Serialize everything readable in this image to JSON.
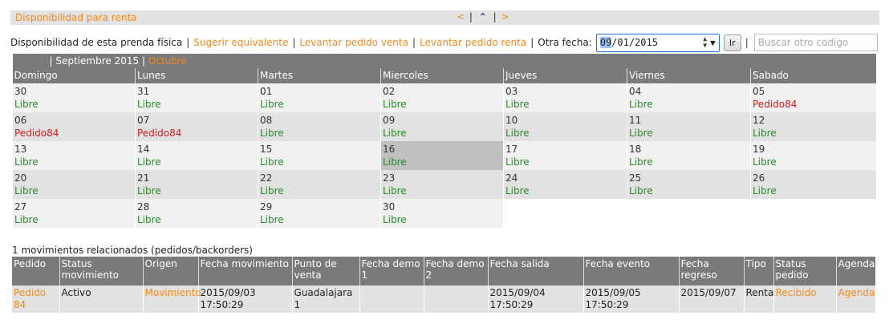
{
  "header": {
    "title": "Disponibilidad para renta",
    "nav_prev": "<",
    "nav_next": ">",
    "nav_sep": "|"
  },
  "actions": {
    "label": "Disponibilidad de esta prenda física",
    "links": [
      "Sugerir equivalente",
      "Levantar pedido venta",
      "Levantar pedido renta"
    ],
    "other_date_label": "Otra fecha:",
    "date_value_highlight": "09",
    "date_value_rest": "/01/2015",
    "go_button": "Ir",
    "search_placeholder": "Buscar otro codigo"
  },
  "calendar": {
    "current_month": "Septiembre 2015",
    "next_month": "Octubre",
    "days_of_week": [
      "Domingo",
      "Lunes",
      "Martes",
      "Miercoles",
      "Jueves",
      "Viernes",
      "Sabado"
    ],
    "weeks": [
      [
        {
          "d": "30",
          "s": "Libre"
        },
        {
          "d": "31",
          "s": "Libre"
        },
        {
          "d": "01",
          "s": "Libre"
        },
        {
          "d": "02",
          "s": "Libre"
        },
        {
          "d": "03",
          "s": "Libre"
        },
        {
          "d": "04",
          "s": "Libre"
        },
        {
          "d": "05",
          "s": "Pedido84"
        }
      ],
      [
        {
          "d": "06",
          "s": "Pedido84"
        },
        {
          "d": "07",
          "s": "Pedido84"
        },
        {
          "d": "08",
          "s": "Libre"
        },
        {
          "d": "09",
          "s": "Libre"
        },
        {
          "d": "10",
          "s": "Libre"
        },
        {
          "d": "11",
          "s": "Libre"
        },
        {
          "d": "12",
          "s": "Libre"
        }
      ],
      [
        {
          "d": "13",
          "s": "Libre"
        },
        {
          "d": "14",
          "s": "Libre"
        },
        {
          "d": "15",
          "s": "Libre"
        },
        {
          "d": "16",
          "s": "Libre"
        },
        {
          "d": "17",
          "s": "Libre"
        },
        {
          "d": "18",
          "s": "Libre"
        },
        {
          "d": "19",
          "s": "Libre"
        }
      ],
      [
        {
          "d": "20",
          "s": "Libre"
        },
        {
          "d": "21",
          "s": "Libre"
        },
        {
          "d": "22",
          "s": "Libre"
        },
        {
          "d": "23",
          "s": "Libre"
        },
        {
          "d": "24",
          "s": "Libre"
        },
        {
          "d": "25",
          "s": "Libre"
        },
        {
          "d": "26",
          "s": "Libre"
        }
      ],
      [
        {
          "d": "27",
          "s": "Libre"
        },
        {
          "d": "28",
          "s": "Libre"
        },
        {
          "d": "29",
          "s": "Libre"
        },
        {
          "d": "30",
          "s": "Libre"
        }
      ]
    ],
    "today": "16"
  },
  "movements": {
    "title": "1 movimientos relacionados (pedidos/backorders)",
    "columns": [
      "Pedido",
      "Status movimiento",
      "Origen",
      "Fecha movimiento",
      "Punto de venta",
      "Fecha demo 1",
      "Fecha demo 2",
      "Fecha salida",
      "Fecha evento",
      "Fecha regreso",
      "Tipo",
      "Status pedido",
      "Agenda"
    ],
    "rows": [
      [
        "Pedido 84",
        "Activo",
        "Movimiento",
        "2015/09/03 17:50:29",
        "Guadalajara 1",
        "",
        "",
        "2015/09/04 17:50:29",
        "2015/09/05 17:50:29",
        "2015/09/07",
        "Renta",
        "Recibido",
        "Agenda"
      ]
    ]
  },
  "colors": {
    "accent": "#f08a1c",
    "free": "#2a8a2a",
    "booked": "#d01c1c",
    "header_bg": "#7a7a7a"
  }
}
